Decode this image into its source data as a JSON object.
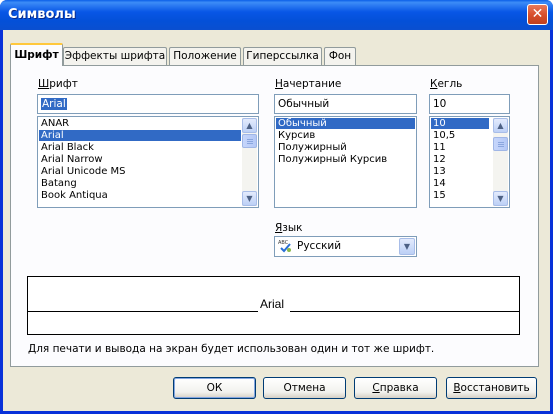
{
  "window": {
    "title": "Символы",
    "close_glyph": "✕"
  },
  "tabs": [
    {
      "label": "Шрифт",
      "active": true
    },
    {
      "label": "Эффекты шрифта"
    },
    {
      "label": "Положение"
    },
    {
      "label": "Гиперссылка"
    },
    {
      "label": "Фон"
    }
  ],
  "font": {
    "label_accel": "Ш",
    "label_rest": "рифт",
    "value": "Arial",
    "items": [
      "ANAR",
      "Arial",
      "Arial Black",
      "Arial Narrow",
      "Arial Unicode MS",
      "Batang",
      "Book Antiqua"
    ],
    "selected_index": 1
  },
  "style": {
    "label_accel": "Н",
    "label_rest": "ачертание",
    "value": "Обычный",
    "items": [
      "Обычный",
      "Курсив",
      "Полужирный",
      "Полужирный Курсив"
    ],
    "selected_index": 0
  },
  "size": {
    "label_accel": "К",
    "label_rest": "егль",
    "value": "10",
    "items": [
      "10",
      "10,5",
      "11",
      "12",
      "13",
      "14",
      "15"
    ],
    "selected_index": 0
  },
  "language": {
    "label_accel": "Я",
    "label_rest": "зык",
    "value": "Русский",
    "icon": "abc-spellcheck-icon"
  },
  "preview": {
    "text": "Arial"
  },
  "info_text": "Для печати и вывода на экран будет использован один и тот же шрифт.",
  "buttons": {
    "ok": "ОК",
    "cancel": "Отмена",
    "help_accel": "С",
    "help_rest": "правка",
    "reset_accel": "В",
    "reset_rest": "осстановить"
  },
  "colors": {
    "selection": "#316ac5",
    "titlebar": "#0856e6",
    "dialog_bg": "#ece9d8"
  }
}
